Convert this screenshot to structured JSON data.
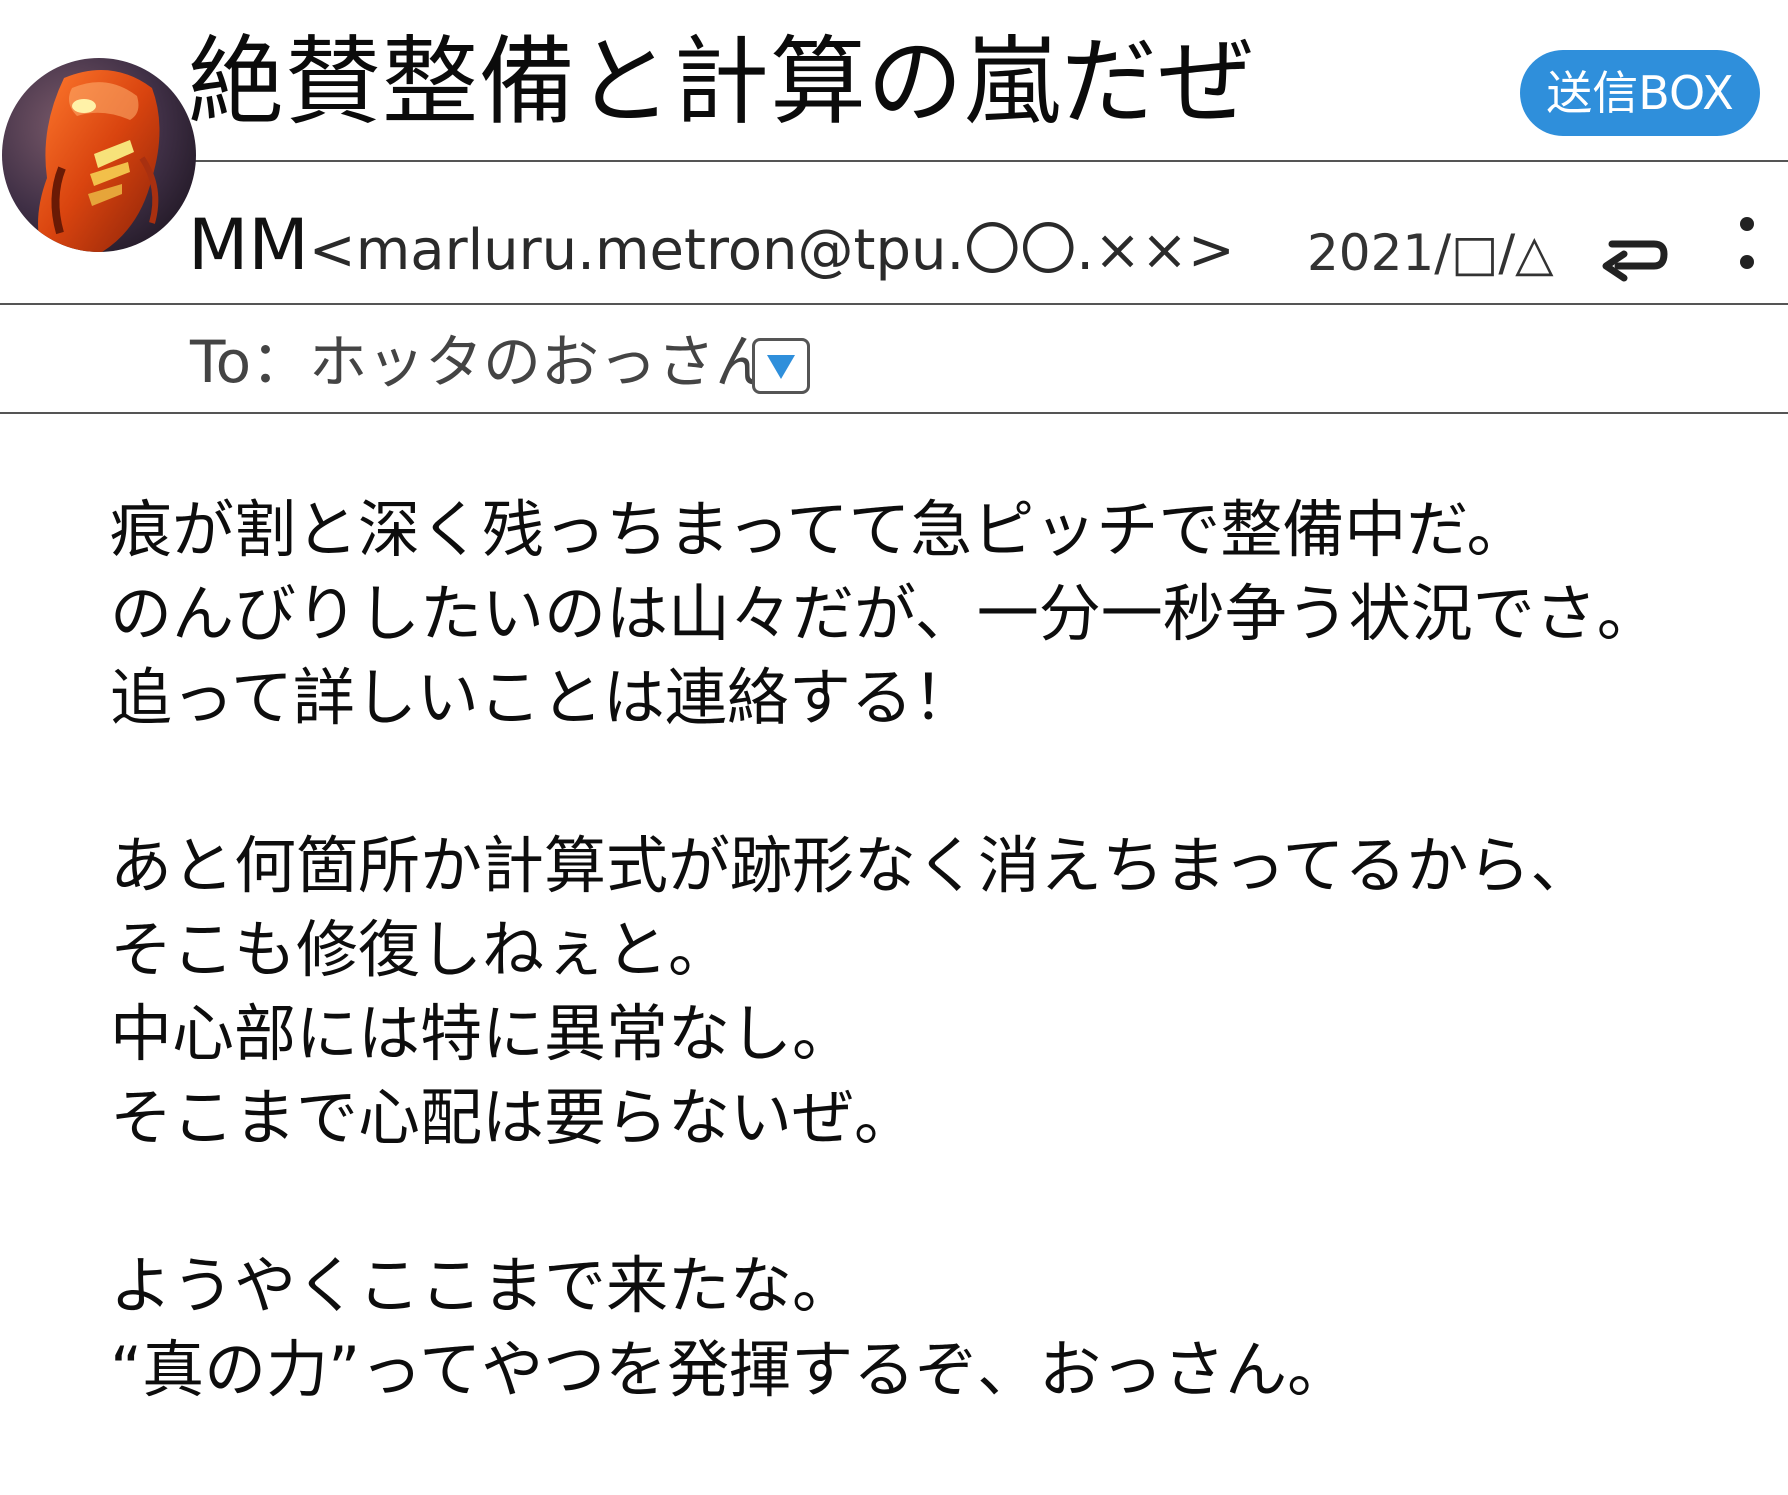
{
  "header": {
    "subject": "絶賛整備と計算の嵐だぜ",
    "sent_box_label": "送信BOX"
  },
  "sender": {
    "name": "MM",
    "address": "<marluru.metron@tpu.〇〇.××>",
    "date": "2021/□/△"
  },
  "recipient": {
    "to_text": "To：ホッタのおっさん"
  },
  "icons": {
    "avatar": "avatar-figure-image",
    "reply": "reply-arrow-icon",
    "more": "more-vertical-icon",
    "expand": "dropdown-triangle-icon"
  },
  "colors": {
    "accent": "#2f8fdb",
    "text": "#111111",
    "divider": "#555555"
  },
  "body": {
    "paragraphs": [
      {
        "lines": [
          "痕が割と深く残っちまってて急ピッチで整備中だ。",
          "のんびりしたいのは山々だが、一分一秒争う状況でさ。",
          "追って詳しいことは連絡する！"
        ]
      },
      {
        "lines": [
          "あと何箇所か計算式が跡形なく消えちまってるから、",
          "そこも修復しねぇと。",
          "中心部には特に異常なし。",
          "そこまで心配は要らないぜ。"
        ]
      },
      {
        "lines": [
          "ようやくここまで来たな。",
          "“真の力”ってやつを発揮するぞ、おっさん。"
        ]
      }
    ]
  }
}
